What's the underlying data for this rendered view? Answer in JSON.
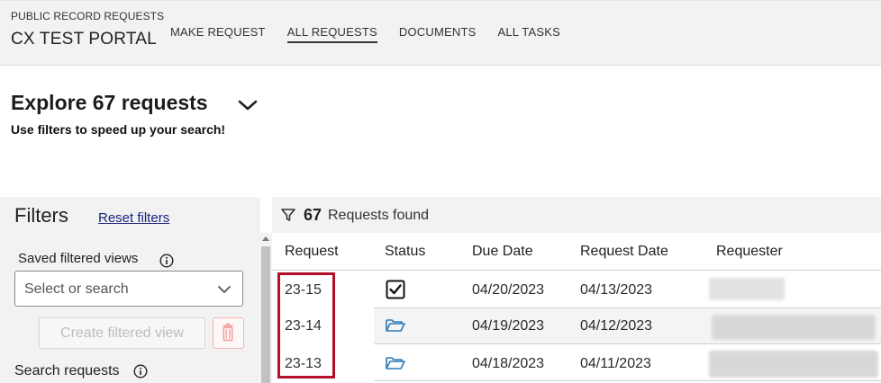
{
  "header": {
    "subtitle": "PUBLIC RECORD REQUESTS",
    "title": "CX TEST PORTAL",
    "nav": [
      {
        "label": "MAKE REQUEST",
        "active": false
      },
      {
        "label": "ALL REQUESTS",
        "active": true
      },
      {
        "label": "DOCUMENTS",
        "active": false
      },
      {
        "label": "ALL TASKS",
        "active": false
      }
    ]
  },
  "explore": {
    "title": "Explore 67 requests",
    "subtitle": "Use filters to speed up your search!"
  },
  "filters": {
    "title": "Filters",
    "reset_label": "Reset filters",
    "saved_views_label": "Saved filtered views",
    "select_placeholder": "Select or search",
    "create_button_label": "Create filtered view",
    "search_label": "Search requests"
  },
  "results": {
    "count": "67",
    "count_label": "Requests found",
    "columns": [
      "Request",
      "Status",
      "Due Date",
      "Request Date",
      "Requester"
    ],
    "rows": [
      {
        "request": "23-15",
        "status_icon": "checkbox-checked-icon",
        "due_date": "04/20/2023",
        "request_date": "04/13/2023"
      },
      {
        "request": "23-14",
        "status_icon": "open-folder-icon",
        "due_date": "04/19/2023",
        "request_date": "04/12/2023"
      },
      {
        "request": "23-13",
        "status_icon": "open-folder-icon",
        "due_date": "04/18/2023",
        "request_date": "04/11/2023"
      }
    ]
  },
  "colors": {
    "highlight": "#b0102a",
    "folder_icon": "#2a7ab8",
    "link": "#1a237e"
  }
}
